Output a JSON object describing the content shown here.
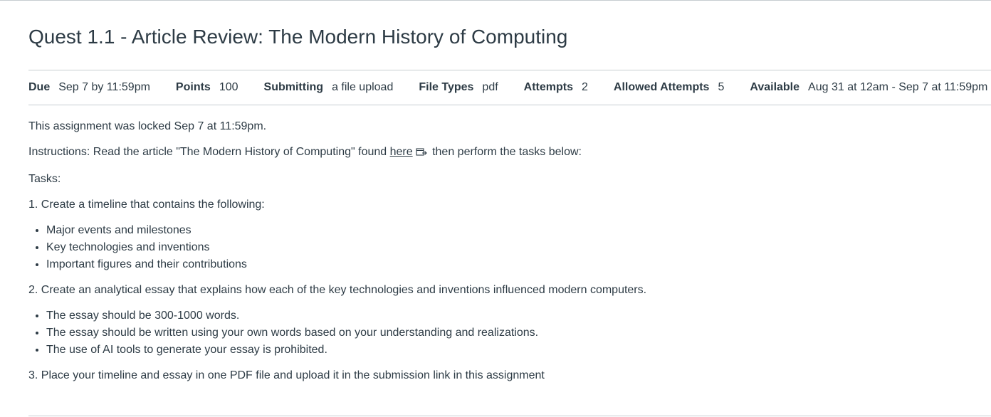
{
  "title": "Quest 1.1 - Article Review: The Modern History of Computing",
  "details": [
    {
      "label": "Due",
      "value": "Sep 7 by 11:59pm"
    },
    {
      "label": "Points",
      "value": "100"
    },
    {
      "label": "Submitting",
      "value": "a file upload"
    },
    {
      "label": "File Types",
      "value": "pdf"
    },
    {
      "label": "Attempts",
      "value": "2"
    },
    {
      "label": "Allowed Attempts",
      "value": "5"
    },
    {
      "label": "Available",
      "value": "Aug 31 at 12am - Sep 7 at 11:59pm"
    }
  ],
  "locked_message": "This assignment was locked Sep 7 at 11:59pm.",
  "instructions": {
    "before": "Instructions: Read the article \"The Modern History of Computing\" found ",
    "link_text": "here",
    "link_icon": "external-link-icon",
    "after": " then perform the tasks below:"
  },
  "tasks_heading": "Tasks:",
  "task1": {
    "text": "1. Create a timeline that contains the following:",
    "items": [
      "Major events and milestones",
      "Key technologies and inventions",
      "Important figures and their contributions"
    ]
  },
  "task2": {
    "text": "2. Create an analytical essay that explains how each of the key technologies and inventions influenced modern computers.",
    "items": [
      "The essay should be 300-1000 words.",
      "The essay should be written using your own words based on your understanding and realizations.",
      "The use of AI tools to generate your essay is prohibited."
    ]
  },
  "task3": {
    "text": "3. Place your timeline and essay in one PDF file and upload it in the submission link in this assignment"
  }
}
